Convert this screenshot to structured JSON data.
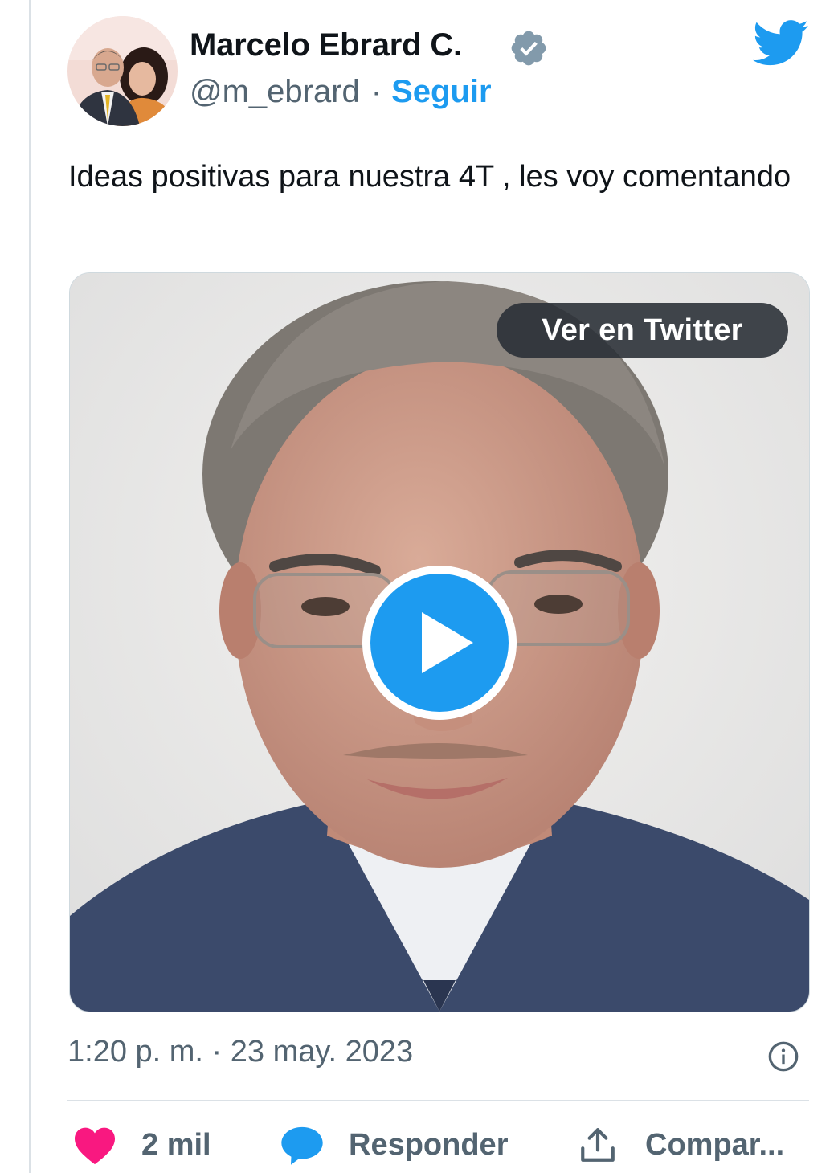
{
  "author": {
    "name": "Marcelo Ebrard C.",
    "handle": "@m_ebrard",
    "separator": "·",
    "follow_label": "Seguir"
  },
  "tweet": {
    "text": "Ideas positivas para nuestra 4T , les voy comentando",
    "timestamp": "1:20 p. m. · 23 may. 2023"
  },
  "media": {
    "view_label": "Ver en Twitter",
    "type": "video"
  },
  "actions": {
    "likes_count": "2 mil",
    "reply_label": "Responder",
    "share_label": "Compar..."
  },
  "icons": {
    "verified": "verified-badge-icon",
    "brand": "twitter-bird-icon",
    "play": "play-icon",
    "info": "info-icon",
    "like": "heart-icon",
    "reply": "speech-bubble-icon",
    "share": "share-upload-icon"
  },
  "colors": {
    "accent": "#1d9bf0",
    "like": "#f91880",
    "muted": "#536471",
    "verified": "#829aab"
  }
}
